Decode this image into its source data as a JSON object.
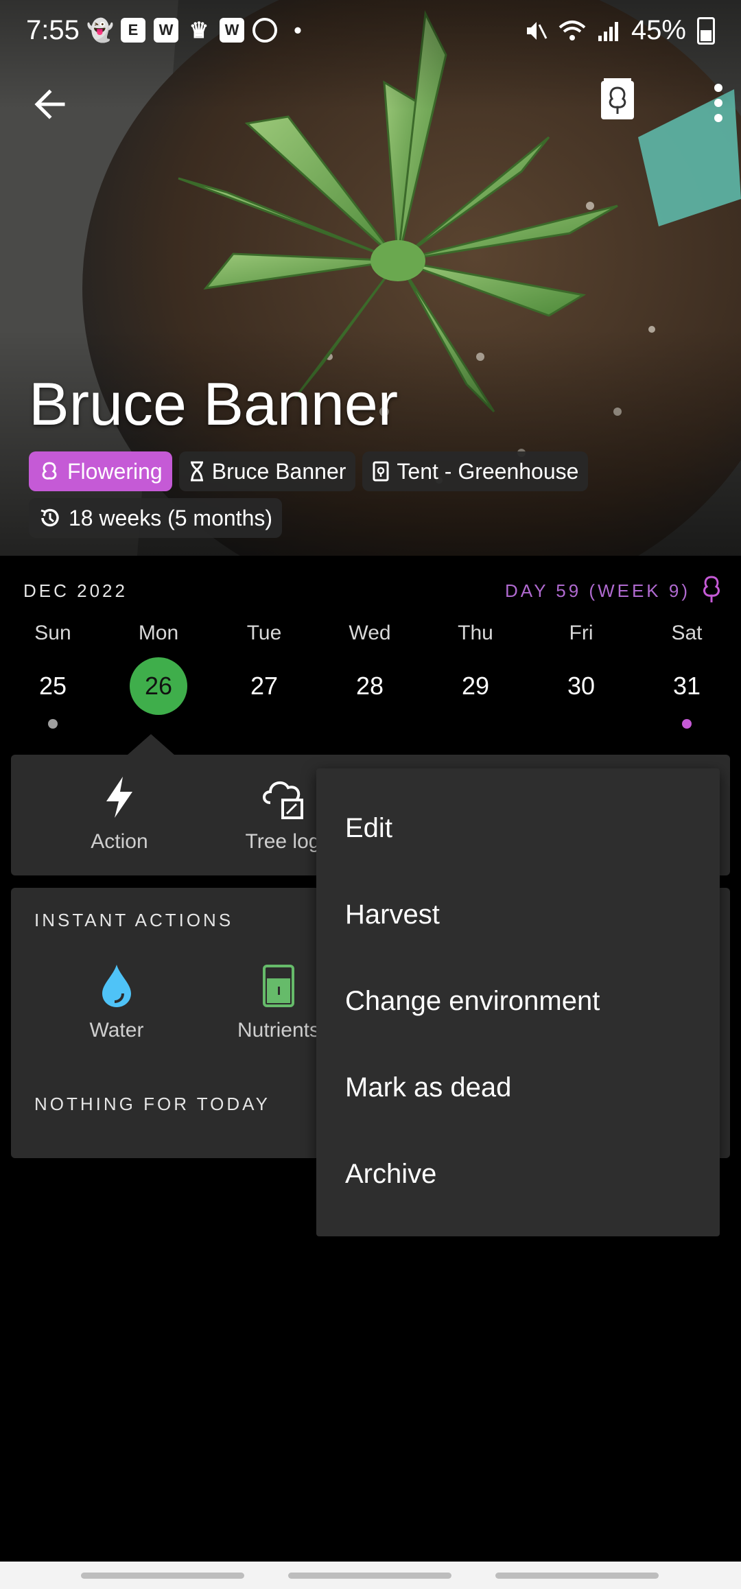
{
  "status": {
    "time": "7:55",
    "notification_icons": [
      "snapchat-icon",
      "espn-icon",
      "w-icon",
      "crown-icon",
      "w-icon",
      "target-icon",
      "dot-icon"
    ],
    "battery": "45%",
    "right_icons": [
      "mute-icon",
      "wifi-icon",
      "signal-icon",
      "battery-icon"
    ]
  },
  "header": {
    "back_icon": "arrow-left-icon",
    "tree_icon": "tree-log-icon",
    "more_icon": "more-vert-icon"
  },
  "plant": {
    "name": "Bruce Banner",
    "stage": "Flowering",
    "strain": "Bruce Banner",
    "environment": "Tent - Greenhouse",
    "age": "18 weeks (5 months)"
  },
  "calendar": {
    "month": "DEC 2022",
    "day_counter": "DAY 59 (WEEK 9)",
    "days": [
      {
        "name": "Sun",
        "num": "25",
        "dot": "#9e9e9e",
        "selected": false
      },
      {
        "name": "Mon",
        "num": "26",
        "dot": "",
        "selected": true
      },
      {
        "name": "Tue",
        "num": "27",
        "dot": "",
        "selected": false
      },
      {
        "name": "Wed",
        "num": "28",
        "dot": "",
        "selected": false
      },
      {
        "name": "Thu",
        "num": "29",
        "dot": "",
        "selected": false
      },
      {
        "name": "Fri",
        "num": "30",
        "dot": "",
        "selected": false
      },
      {
        "name": "Sat",
        "num": "31",
        "dot": "#c55ad6",
        "selected": false
      }
    ]
  },
  "tabs": {
    "action_label": "Action",
    "treelog_label": "Tree log"
  },
  "instant_actions": {
    "title": "INSTANT ACTIONS",
    "water_label": "Water",
    "nutrients_label": "Nutrients",
    "nothing_label": "NOTHING FOR TODAY"
  },
  "menu": {
    "items": [
      "Edit",
      "Harvest",
      "Change environment",
      "Mark as dead",
      "Archive"
    ]
  },
  "colors": {
    "accent_purple": "#c55ad6",
    "selected_green": "#3fae4b",
    "water_blue": "#4fc3f7",
    "nutrient_green": "#66bb6a",
    "card_bg": "#2c2c2c"
  }
}
